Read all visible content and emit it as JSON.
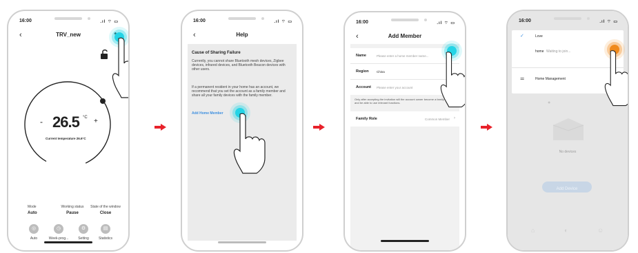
{
  "screen1": {
    "time": "16:00",
    "title": "TRV_new",
    "temperature": "26.5",
    "temp_unit": "°C",
    "minus": "-",
    "plus": "+",
    "current_temp_label": "Current temperature",
    "current_temp_value": "26.6°C",
    "status": [
      {
        "label": "Mode",
        "value": "Auto"
      },
      {
        "label": "Working status",
        "value": "Pause"
      },
      {
        "label": "State of the window",
        "value": "Close"
      }
    ],
    "tabs": [
      "Auto",
      "Week-prog...",
      "Setting",
      "Statistics"
    ]
  },
  "screen2": {
    "time": "16:00",
    "title": "Help",
    "heading": "Cause of Sharing Failure",
    "para1": "Currently, you cannot share Bluetooth mesh devices, Zigbee devices, infrared devices, and Bluetooth Beacon devices with other users.",
    "para2": "If a permanent resident in your home has an account, we recommend that you set the account as a family member and share all your family devices with the family member.",
    "link": "Add Home Member"
  },
  "screen3": {
    "time": "16:00",
    "title": "Add Member",
    "name_label": "Name",
    "name_placeholder": "Please enter a home member name...",
    "region_label": "Region",
    "region_value": "China",
    "account_label": "Account",
    "account_placeholder": "Please enter your account",
    "note": "Only after accepting the invitation will the account owner become a family member and be able to use relevant functions.",
    "role_label": "Family Role",
    "role_value": "Common Member"
  },
  "screen4": {
    "time": "16:00",
    "home_item": "Love",
    "pending_name": "home",
    "pending_status": "Waiting to join...",
    "management": "Home Management",
    "no_devices": "No devices",
    "add_device": "Add Device"
  }
}
